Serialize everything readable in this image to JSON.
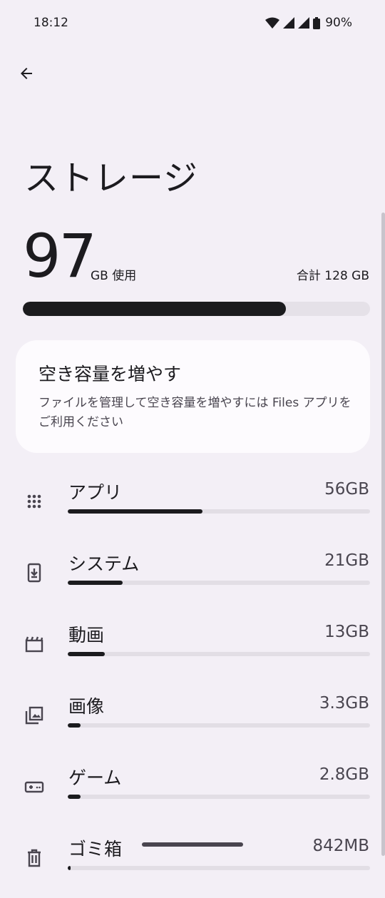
{
  "status_bar": {
    "time": "18:12",
    "battery": "90%"
  },
  "header": {
    "title": "ストレージ"
  },
  "usage": {
    "used": "97",
    "used_unit": "GB 使用",
    "total": "合計 128 GB",
    "used_fraction": 0.758
  },
  "card": {
    "title": "空き容量を増やす",
    "text": "ファイルを管理して空き容量を増やすには Files アプリをご利用ください"
  },
  "categories": [
    {
      "label": "アプリ",
      "value": "56GB",
      "fraction": 0.445,
      "icon": "apps-grid-icon"
    },
    {
      "label": "システム",
      "value": "21GB",
      "fraction": 0.182,
      "icon": "system-update-icon"
    },
    {
      "label": "動画",
      "value": "13GB",
      "fraction": 0.123,
      "icon": "movie-clapper-icon"
    },
    {
      "label": "画像",
      "value": "3.3GB",
      "fraction": 0.043,
      "icon": "photo-library-icon"
    },
    {
      "label": "ゲーム",
      "value": "2.8GB",
      "fraction": 0.043,
      "icon": "gamepad-icon"
    },
    {
      "label": "ゴミ箱",
      "value": "842MB",
      "fraction": 0.01,
      "icon": "trash-icon"
    }
  ]
}
